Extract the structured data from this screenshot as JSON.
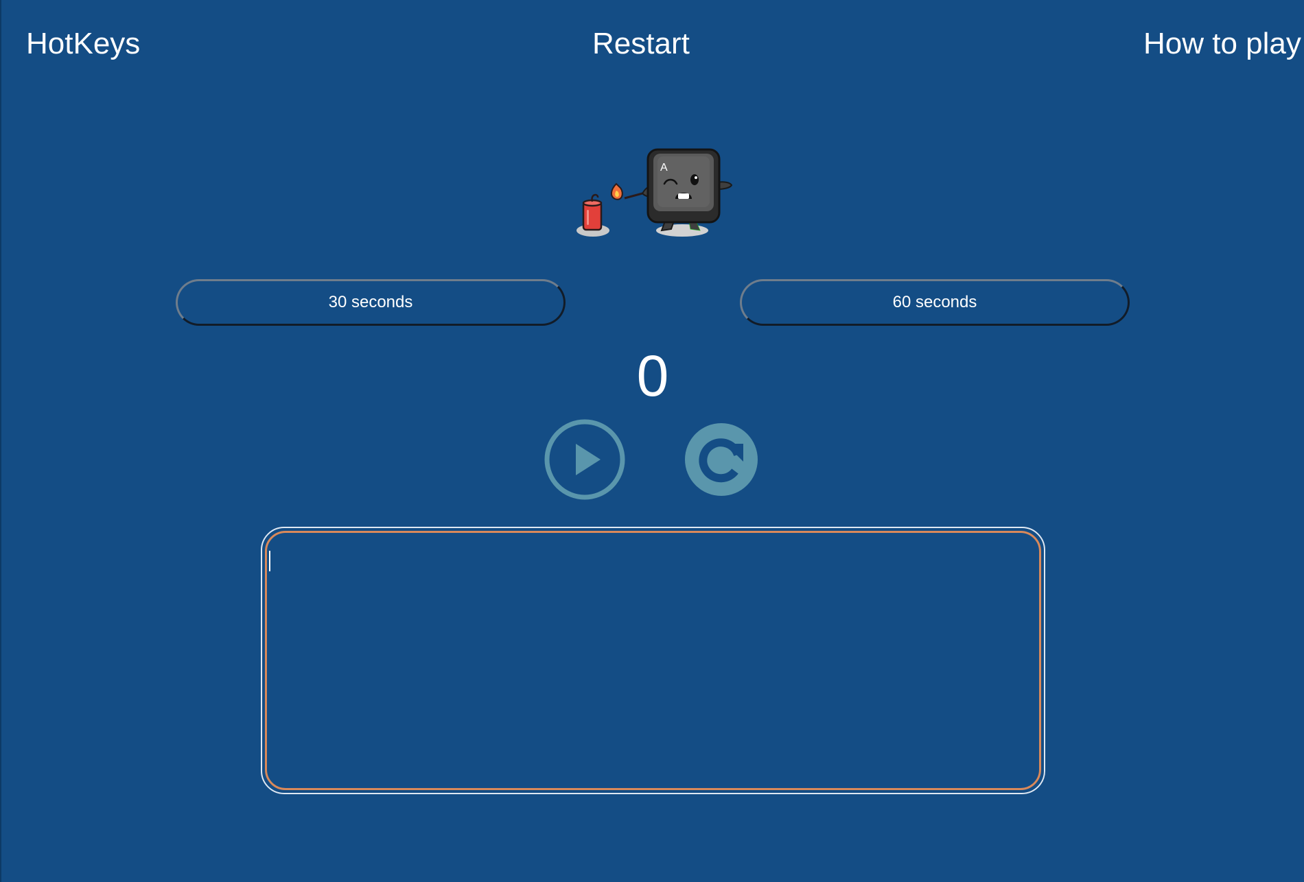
{
  "nav": {
    "brand": "HotKeys",
    "restart": "Restart",
    "how_to_play": "How to play"
  },
  "mascot": {
    "key_letter": "A"
  },
  "durations": [
    {
      "label": "30 seconds"
    },
    {
      "label": "60 seconds"
    }
  ],
  "score": "0",
  "controls": {
    "play_icon": "play-icon",
    "reset_icon": "reset-icon"
  },
  "typing_area": {
    "value": "",
    "placeholder": ""
  },
  "colors": {
    "background": "#144d85",
    "control_accent": "#5a96ac",
    "typing_border": "#d9895a",
    "fuse_flame": "#f0703a",
    "dynamite": "#e2403a"
  }
}
